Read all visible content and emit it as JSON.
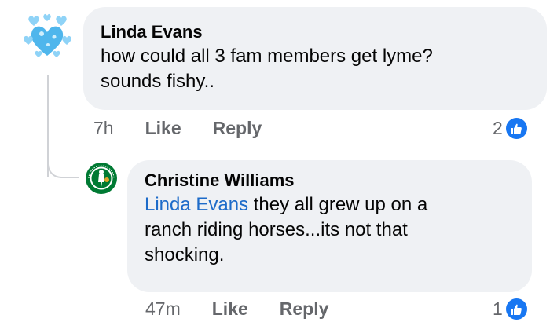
{
  "comments": [
    {
      "author": "Linda Evans",
      "text_line1": "how could all 3 fam members get lyme?",
      "text_line2": "sounds fishy..",
      "time": "7h",
      "like_label": "Like",
      "reply_label": "Reply",
      "reaction_count": "2",
      "avatar_icon": "blue-hearts-icon"
    },
    {
      "author": "Christine Williams",
      "mention": "Linda Evans",
      "text_line1_rest": " they all grew up on a",
      "text_line2": "ranch riding horses...its not that",
      "text_line3": "shocking.",
      "time": "47m",
      "like_label": "Like",
      "reply_label": "Reply",
      "reaction_count": "1",
      "avatar_icon": "celtics-logo-icon"
    }
  ],
  "colors": {
    "bubble": "#eff1f4",
    "mention": "#1d6bc9",
    "like_badge": "#1877f2",
    "meta_text": "#65676b"
  }
}
